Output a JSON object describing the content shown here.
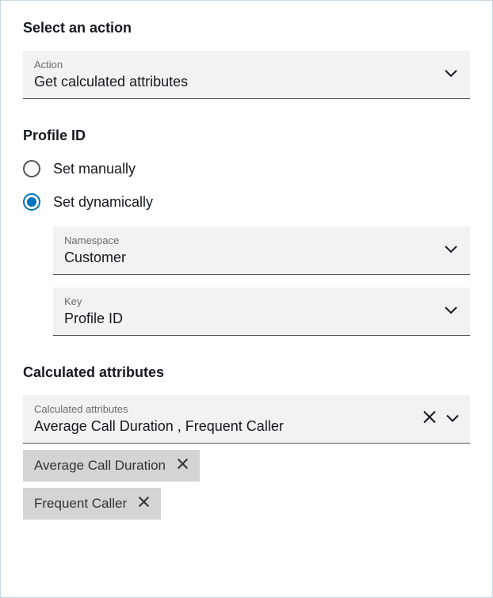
{
  "action_section": {
    "title": "Select an action",
    "dropdown": {
      "label": "Action",
      "value": "Get calculated attributes"
    }
  },
  "profile_section": {
    "title": "Profile ID",
    "radios": {
      "manual": {
        "label": "Set manually",
        "selected": false
      },
      "dynamic": {
        "label": "Set dynamically",
        "selected": true
      }
    },
    "namespace": {
      "label": "Namespace",
      "value": "Customer"
    },
    "key": {
      "label": "Key",
      "value": "Profile ID"
    }
  },
  "calc_section": {
    "title": "Calculated attributes",
    "dropdown": {
      "label": "Calculated attributes",
      "value": "Average Call Duration , Frequent Caller"
    },
    "chips": [
      {
        "label": "Average Call Duration"
      },
      {
        "label": "Frequent Caller"
      }
    ]
  }
}
